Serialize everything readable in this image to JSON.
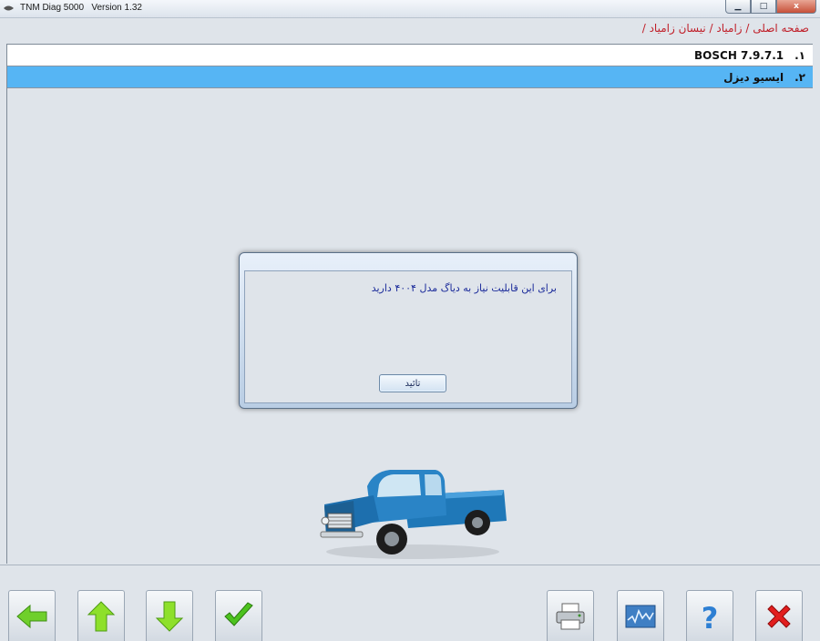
{
  "window": {
    "app_name": "TNM Diag 5000",
    "version": "Version 1.32",
    "minimize_symbol": "▁",
    "maximize_symbol": "□",
    "close_symbol": "x"
  },
  "breadcrumb": "صفحه اصلی / زامیاد / نیسان زامیاد /",
  "list": {
    "items": [
      {
        "num": "۱.",
        "label": "BOSCH 7.9.7.1",
        "selected": false
      },
      {
        "num": "۲.",
        "label": "ایسیو دیزل",
        "selected": true
      }
    ]
  },
  "dialog": {
    "message": "برای این قابلیت نیاز به دیاگ مدل ۴۰۰۴ دارید",
    "ok_label": "تائید"
  },
  "toolbar": {
    "left_icons": [
      "back-arrow-icon",
      "up-arrow-icon",
      "down-arrow-icon",
      "checkmark-icon"
    ],
    "right_icons": [
      "printer-icon",
      "graph-icon",
      "help-icon",
      "close-icon"
    ]
  },
  "colors": {
    "selected_row": "#56b5f4",
    "breadcrumb_text": "#c0202a",
    "dialog_text": "#1a2a9a",
    "arrow_green": "#6fcf2b",
    "close_red": "#e21e1e"
  }
}
